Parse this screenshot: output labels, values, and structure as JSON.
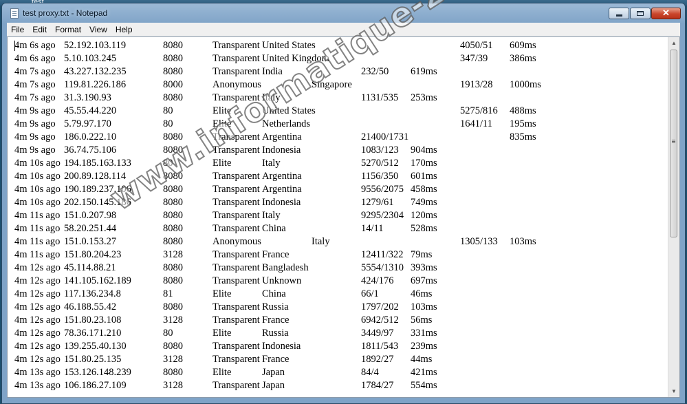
{
  "window": {
    "title": "test proxy.txt - Notepad",
    "background_label": "test ..."
  },
  "menu": [
    "File",
    "Edit",
    "Format",
    "View",
    "Help"
  ],
  "lines": [
    [
      "4m 6s ago",
      "52.192.103.119",
      "8080",
      "Transparent",
      "United States",
      "",
      "",
      "",
      "4050/51",
      "609ms"
    ],
    [
      "4m 6s ago",
      "5.10.103.245",
      "8080",
      "Transparent",
      "United Kingdom",
      "",
      "",
      "",
      "347/39",
      "386ms"
    ],
    [
      "4m 7s ago",
      "43.227.132.235",
      "8080",
      "Transparent",
      "India",
      "",
      "232/50",
      "619ms",
      "",
      ""
    ],
    [
      "4m 7s ago",
      "119.81.226.186",
      "8000",
      "Anonymous",
      "",
      "Singapore",
      "",
      "",
      "1913/28",
      "1000ms"
    ],
    [
      "4m 7s ago",
      "31.3.190.93",
      "8080",
      "Transparent",
      "Italy",
      "",
      "1131/535",
      "253ms",
      "",
      ""
    ],
    [
      "4m 9s ago",
      "45.55.44.220",
      "80",
      "Elite",
      "United States",
      "",
      "",
      "",
      "5275/816",
      "488ms"
    ],
    [
      "4m 9s ago",
      "5.79.97.170",
      "80",
      "Elite",
      "Netherlands",
      "",
      "",
      "",
      "1641/11",
      "195ms"
    ],
    [
      "4m 9s ago",
      "186.0.222.10",
      "8080",
      "Transparent",
      "Argentina",
      "",
      "21400/1731",
      "",
      "",
      "835ms"
    ],
    [
      "4m 9s ago",
      "36.74.75.106",
      "8080",
      "Transparent",
      "Indonesia",
      "",
      "1083/123",
      "904ms",
      "",
      ""
    ],
    [
      "4m 10s ago",
      "194.185.163.133",
      "80",
      "Elite",
      "Italy",
      "",
      "5270/512",
      "170ms",
      "",
      ""
    ],
    [
      "4m 10s ago",
      "200.89.128.114",
      "8080",
      "Transparent",
      "Argentina",
      "",
      "1156/350",
      "601ms",
      "",
      ""
    ],
    [
      "4m 10s ago",
      "190.189.237.106",
      "8080",
      "Transparent",
      "Argentina",
      "",
      "9556/2075",
      "458ms",
      "",
      ""
    ],
    [
      "4m 10s ago",
      "202.150.145.186",
      "8080",
      "Transparent",
      "Indonesia",
      "",
      "1279/61",
      "749ms",
      "",
      ""
    ],
    [
      "4m 11s ago",
      "151.0.207.98",
      "8080",
      "Transparent",
      "Italy",
      "",
      "9295/2304",
      "120ms",
      "",
      ""
    ],
    [
      "4m 11s ago",
      "58.20.251.44",
      "8080",
      "Transparent",
      "China",
      "",
      "14/11",
      "528ms",
      "",
      ""
    ],
    [
      "4m 11s ago",
      "151.0.153.27",
      "8080",
      "Anonymous",
      "",
      "Italy",
      "",
      "",
      "1305/133",
      "103ms"
    ],
    [
      "4m 11s ago",
      "151.80.204.23",
      "3128",
      "Transparent",
      "France",
      "",
      "12411/322",
      "79ms",
      "",
      ""
    ],
    [
      "4m 12s ago",
      "45.114.88.21",
      "8080",
      "Transparent",
      "Bangladesh",
      "",
      "5554/1310",
      "393ms",
      "",
      ""
    ],
    [
      "4m 12s ago",
      "141.105.162.189",
      "8080",
      "Transparent",
      "Unknown",
      "",
      "424/176",
      "697ms",
      "",
      ""
    ],
    [
      "4m 12s ago",
      "117.136.234.8",
      "81",
      "Elite",
      "China",
      "",
      "66/1",
      "46ms",
      "",
      ""
    ],
    [
      "4m 12s ago",
      "46.188.55.42",
      "8080",
      "Transparent",
      "Russia",
      "",
      "1797/202",
      "103ms",
      "",
      ""
    ],
    [
      "4m 12s ago",
      "151.80.23.108",
      "3128",
      "Transparent",
      "France",
      "",
      "6942/512",
      "56ms",
      "",
      ""
    ],
    [
      "4m 12s ago",
      "78.36.171.210",
      "80",
      "Elite",
      "Russia",
      "",
      "3449/97",
      "331ms",
      "",
      ""
    ],
    [
      "4m 12s ago",
      "139.255.40.130",
      "8080",
      "Transparent",
      "Indonesia",
      "",
      "1811/543",
      "239ms",
      "",
      ""
    ],
    [
      "4m 12s ago",
      "151.80.25.135",
      "3128",
      "Transparent",
      "France",
      "",
      "1892/27",
      "44ms",
      "",
      ""
    ],
    [
      "4m 13s ago",
      "153.126.148.239",
      "8080",
      "Elite",
      "Japan",
      "",
      "84/4",
      "421ms",
      "",
      ""
    ],
    [
      "4m 13s ago",
      "106.186.27.109",
      "3128",
      "Transparent",
      "Japan",
      "",
      "1784/27",
      "554ms",
      "",
      ""
    ]
  ],
  "watermark": "www.informatique-zone.com",
  "icons": {
    "app": "notepad-icon",
    "minimize": "minimize-icon",
    "maximize": "maximize-icon",
    "close": "close-icon",
    "scroll_up": "arrow-up-icon",
    "scroll_down": "arrow-down-icon"
  },
  "colors": {
    "close_button": "#c9452a",
    "titlebar": "#9bb9d6",
    "desktop": "#1c4f6e"
  }
}
